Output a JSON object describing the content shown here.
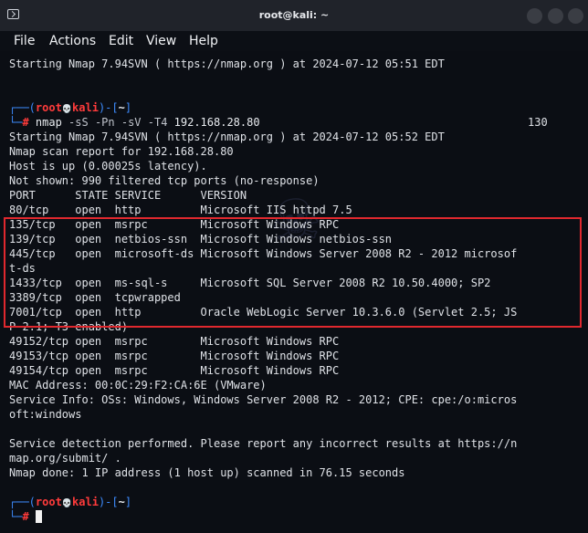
{
  "window": {
    "title": "root@kali: ~",
    "icon": "terminal-icon",
    "controls": [
      "minimize-button",
      "maximize-button",
      "close-button"
    ]
  },
  "menu": {
    "file": "File",
    "actions": "Actions",
    "edit": "Edit",
    "view": "View",
    "help": "Help"
  },
  "terminal": {
    "line_start_prev": "Starting Nmap 7.94SVN ( https://nmap.org ) at 2024-07-12 05:51 EDT",
    "prompt_user": "root",
    "prompt_host": "kali",
    "prompt_skull": "💀",
    "prompt_dir": "~",
    "command_bin": "nmap",
    "command_flags": " -sS -Pn -sV -T4",
    "command_target": " 192.168.28.80",
    "exit_code": "130",
    "lines": [
      "Starting Nmap 7.94SVN ( https://nmap.org ) at 2024-07-12 05:52 EDT",
      "Nmap scan report for 192.168.28.80",
      "Host is up (0.00025s latency).",
      "Not shown: 990 filtered tcp ports (no-response)",
      "PORT      STATE SERVICE      VERSION",
      "80/tcp    open  http         Microsoft IIS httpd 7.5",
      "135/tcp   open  msrpc        Microsoft Windows RPC",
      "139/tcp   open  netbios-ssn  Microsoft Windows netbios-ssn",
      "445/tcp   open  microsoft-ds Microsoft Windows Server 2008 R2 - 2012 microsof",
      "t-ds",
      "1433/tcp  open  ms-sql-s     Microsoft SQL Server 2008 R2 10.50.4000; SP2",
      "3389/tcp  open  tcpwrapped",
      "7001/tcp  open  http         Oracle WebLogic Server 10.3.6.0 (Servlet 2.5; JS",
      "P 2.1; T3 enabled)",
      "49152/tcp open  msrpc        Microsoft Windows RPC",
      "49153/tcp open  msrpc        Microsoft Windows RPC",
      "49154/tcp open  msrpc        Microsoft Windows RPC",
      "MAC Address: 00:0C:29:F2:CA:6E (VMware)",
      "Service Info: OSs: Windows, Windows Server 2008 R2 - 2012; CPE: cpe:/o:micros",
      "oft:windows",
      "",
      "Service detection performed. Please report any incorrect results at https://n",
      "map.org/submit/ .",
      "Nmap done: 1 IP address (1 host up) scanned in 76.15 seconds"
    ]
  },
  "colors": {
    "prompt_frame": "#3d8cff",
    "prompt_user": "#ff3b3b",
    "highlight_box": "#e0282e",
    "background": "#0b0e14"
  }
}
